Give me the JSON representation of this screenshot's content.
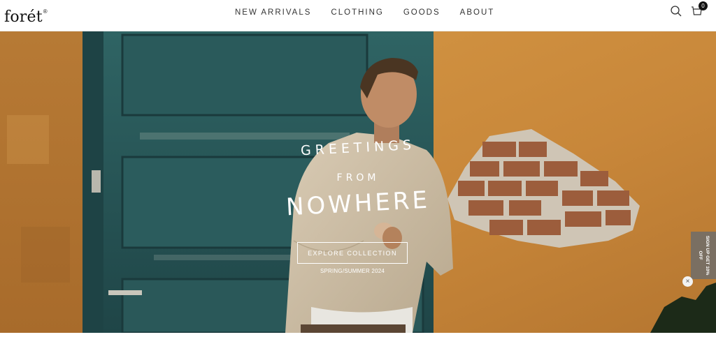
{
  "brand": {
    "logo_text": "forét",
    "registered": "®"
  },
  "nav": {
    "items": [
      {
        "label": "NEW ARRIVALS"
      },
      {
        "label": "CLOTHING"
      },
      {
        "label": "GOODS"
      },
      {
        "label": "ABOUT"
      }
    ]
  },
  "header_icons": {
    "search": "search-icon",
    "cart": "cart-icon",
    "cart_count": "0"
  },
  "hero": {
    "title_line1": "Greetings",
    "title_line2": "from",
    "title_line3": "Nowhere",
    "cta_label": "EXPLORE COLLECTION",
    "season": "SPRING/SUMMER 2024"
  },
  "signup_tab": {
    "label": "SIGN UP GET 10% OFF",
    "close": "×"
  },
  "colors": {
    "wall": "#c98a3a",
    "door": "#2d5b5c",
    "text": "#ffffff"
  }
}
